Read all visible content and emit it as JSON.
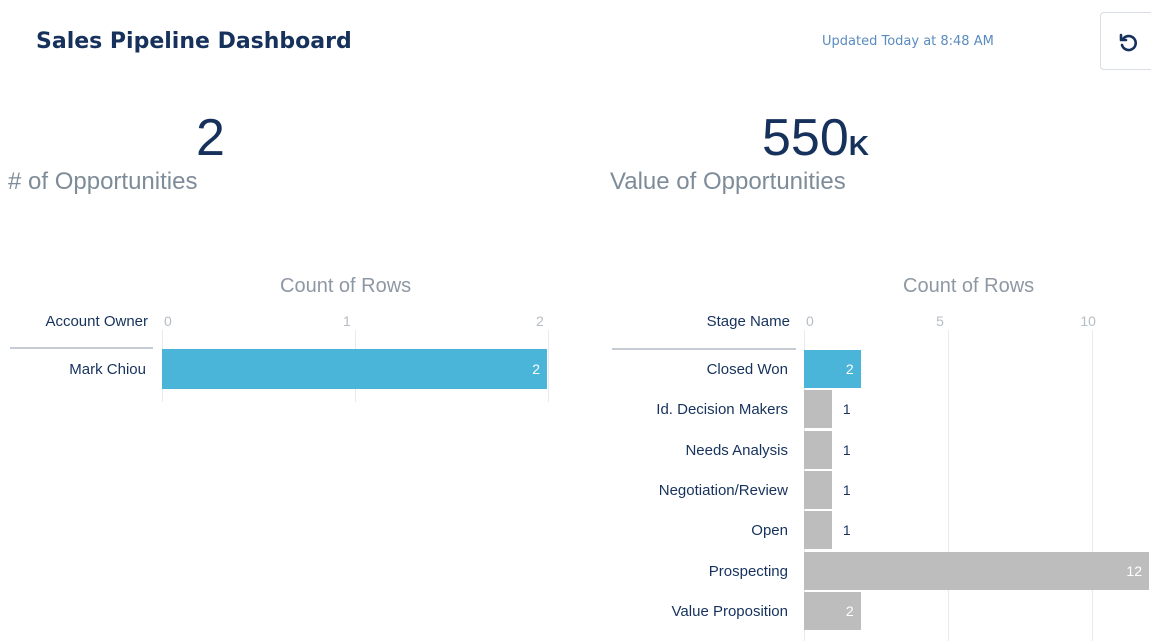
{
  "header": {
    "title": "Sales Pipeline Dashboard",
    "updated": "Updated Today at 8:48 AM",
    "refresh_icon": "refresh-icon"
  },
  "metrics": [
    {
      "value": "2",
      "unit": "",
      "label": "# of Opportunities"
    },
    {
      "value": "550",
      "unit": "K",
      "label": "Value of Opportunities"
    }
  ],
  "colors": {
    "highlight": "#4bb4d9",
    "default": "#bdbdbd",
    "title": "#16325c"
  },
  "chart_data": [
    {
      "type": "bar",
      "orientation": "horizontal",
      "title": "Count of Rows",
      "dimension": "Account Owner",
      "categories": [
        "Mark Chiou"
      ],
      "values": [
        2
      ],
      "ticks": [
        "0",
        "1",
        "2"
      ],
      "xlim": [
        0,
        2
      ],
      "highlighted": [
        "Mark Chiou"
      ]
    },
    {
      "type": "bar",
      "orientation": "horizontal",
      "title": "Count of Rows",
      "dimension": "Stage Name",
      "categories": [
        "Closed Won",
        "Id. Decision Makers",
        "Needs Analysis",
        "Negotiation/Review",
        "Open",
        "Prospecting",
        "Value Proposition"
      ],
      "values": [
        2,
        1,
        1,
        1,
        1,
        12,
        2
      ],
      "ticks": [
        "0",
        "5",
        "10"
      ],
      "xlim": [
        0,
        12
      ],
      "highlighted": [
        "Closed Won"
      ]
    }
  ]
}
